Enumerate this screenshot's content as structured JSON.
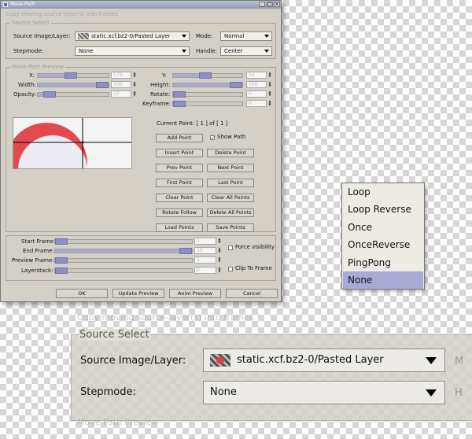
{
  "window": {
    "title": "Move Path",
    "subtitle": "Copy moving source-layer(s) into frames"
  },
  "source_select": {
    "caption": "Source Select",
    "source_label": "Source Image/Layer:",
    "source_value": "static.xcf.bz2-0/Pasted Layer",
    "mode_label": "Mode:",
    "mode_value": "Normal",
    "stepmode_label": "Stepmode:",
    "stepmode_value": "None",
    "handle_label": "Handle:",
    "handle_value": "Center"
  },
  "preview": {
    "caption": "Move Path Preview",
    "params": [
      {
        "label": "X:",
        "value": "179",
        "fraction": 0.47
      },
      {
        "label": "Width:",
        "value": "100",
        "fraction": 0.97
      },
      {
        "label": "Opacity:",
        "value": "17",
        "fraction": 0.17
      },
      {
        "label": "Y:",
        "value": "54",
        "fraction": 0.47
      },
      {
        "label": "Height:",
        "value": "100",
        "fraction": 0.97
      },
      {
        "label": "Rotate:",
        "value": "0",
        "fraction": 0.03
      },
      {
        "label": "Keyframe:",
        "value": "0",
        "fraction": 0.03
      }
    ],
    "current_point_label": "Current Point: [",
    "current_point": "1",
    "of_label": "] of [",
    "total_points": "1",
    "close_bracket": "]",
    "show_path_label": "Show Path",
    "buttons": [
      "Add Point",
      "Insert Point",
      "Prev Point",
      "First Point",
      "Clear Point",
      "Rotate Follow",
      "Load Points",
      "Delete Point",
      "Next Point",
      "Last Point",
      "Clear All Points",
      "Delete All Points",
      "Save Points"
    ]
  },
  "frames": {
    "params": [
      {
        "label": "Start Frame:",
        "value": "1",
        "fraction": 0.02
      },
      {
        "label": "End Frame:",
        "value": "10",
        "fraction": 0.97
      },
      {
        "label": "Preview Frame:",
        "value": "1",
        "fraction": 0.02
      },
      {
        "label": "Layerstack:",
        "value": "0",
        "fraction": 0.02
      }
    ],
    "force_visibility_label": "Force visibility",
    "clip_to_frame_label": "Clip To Frame"
  },
  "dialog_buttons": {
    "ok": "OK",
    "update_preview": "Update Preview",
    "anim_preview": "Anim Preview",
    "cancel": "Cancel"
  },
  "stepmode_options": [
    "Loop",
    "Loop Reverse",
    "Once",
    "OnceReverse",
    "PingPong",
    "None"
  ],
  "stepmode_selected": "None",
  "zoom": {
    "caption": "Copy moving source-layer(s) into frames",
    "section": "Source Select",
    "source_label": "Source Image/Layer:",
    "source_value": "static.xcf.bz2-0/Pasted Layer",
    "stepmode_label": "Stepmode:",
    "stepmode_value": "None",
    "bottom_caption": "Move Path Preview"
  }
}
